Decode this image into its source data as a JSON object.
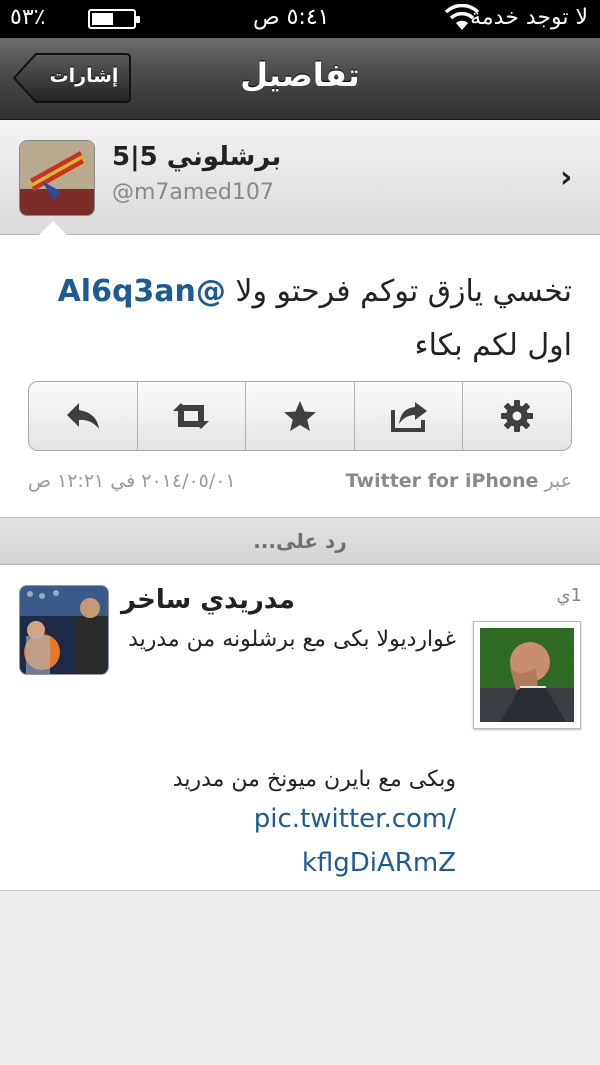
{
  "status_bar": {
    "carrier": "لا توجد خدمة",
    "time": "٥:٤١ ص",
    "battery_percent": "٪٥٣",
    "battery_level": 0.53
  },
  "nav": {
    "title": "تفاصيل",
    "back_label": "إشارات"
  },
  "profile": {
    "name": "برشلوني 5|5",
    "handle": "@m7amed107"
  },
  "tweet": {
    "text_line1_plain": "تخسي يازق توكم فرحتو ولا ",
    "mention": "@Al6q3an",
    "text_line2": "اول لكم بكاء",
    "via_prefix": "عبر",
    "via_app": "Twitter for iPhone",
    "date": "٢٠١٤/٠٥/٠١ في ١٢:٢١ ص"
  },
  "actions": [
    {
      "icon": "reply-icon"
    },
    {
      "icon": "retweet-icon"
    },
    {
      "icon": "star-icon"
    },
    {
      "icon": "share-icon"
    },
    {
      "icon": "gear-icon"
    }
  ],
  "section_header": "رد على...",
  "reply": {
    "name": "مدريدي ساخر",
    "time": "1ي",
    "text_part1": "غوارديولا بكى مع برشلونه من مدريد",
    "text_part2": "وبكى مع بايرن ميونخ من مدريد",
    "link_line1": "pic.twitter.com/",
    "link_line2": "kflgDiARmZ"
  },
  "colors": {
    "link": "#1f5b93",
    "nav_bg": "#3c3c3c"
  }
}
